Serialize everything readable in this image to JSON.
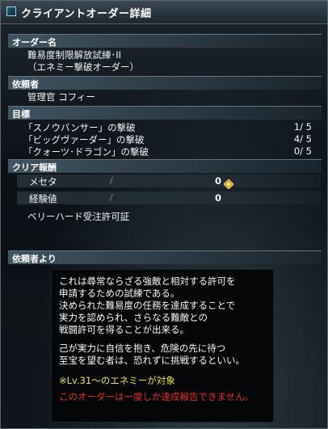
{
  "window": {
    "title": "クライアントオーダー詳細"
  },
  "order_name": {
    "header": "オーダー名",
    "line1": "難易度制限解放試練･II",
    "line2": "（エネミー撃破オーダー）"
  },
  "requester": {
    "header": "依頼者",
    "name": "管理官 コフィー"
  },
  "goals": {
    "header": "目標",
    "items": [
      {
        "label": "「スノウバンサー」の撃破",
        "progress": "1/ 5"
      },
      {
        "label": "「ビッグヴァーダー」の撃破",
        "progress": "4/ 5"
      },
      {
        "label": "「クォーツ･ドラゴン」の撃破",
        "progress": "0/ 5"
      }
    ]
  },
  "rewards": {
    "header": "クリア報酬",
    "meseta_label": "メセタ",
    "meseta_value": "0",
    "exp_label": "経験値",
    "exp_value": "0",
    "slash": "/",
    "unlock": "ベリーハード受注許可証"
  },
  "message": {
    "header": "依頼者より",
    "lines": [
      "これは尋常ならざる強敵と相対する許可を",
      "申請するための試練である。",
      "決められた難易度の任務を達成することで",
      "実力を認められ、さらなる難敵との",
      "戦闘許可を得ることが出来る。",
      "",
      "己が実力に自信を抱き、危険の先に待つ",
      "至宝を望む者は、恐れずに挑戦するといい。"
    ],
    "note": "※Lv.31～のエネミーが対象",
    "warning": "このオーダーは一度しか達成報告できません。"
  },
  "colors": {
    "note": "#e7e24a",
    "warning": "#e32b22",
    "header_bg": "#3f5461"
  },
  "icons": {
    "title": "window-icon",
    "meseta": "meseta-coin-icon"
  }
}
